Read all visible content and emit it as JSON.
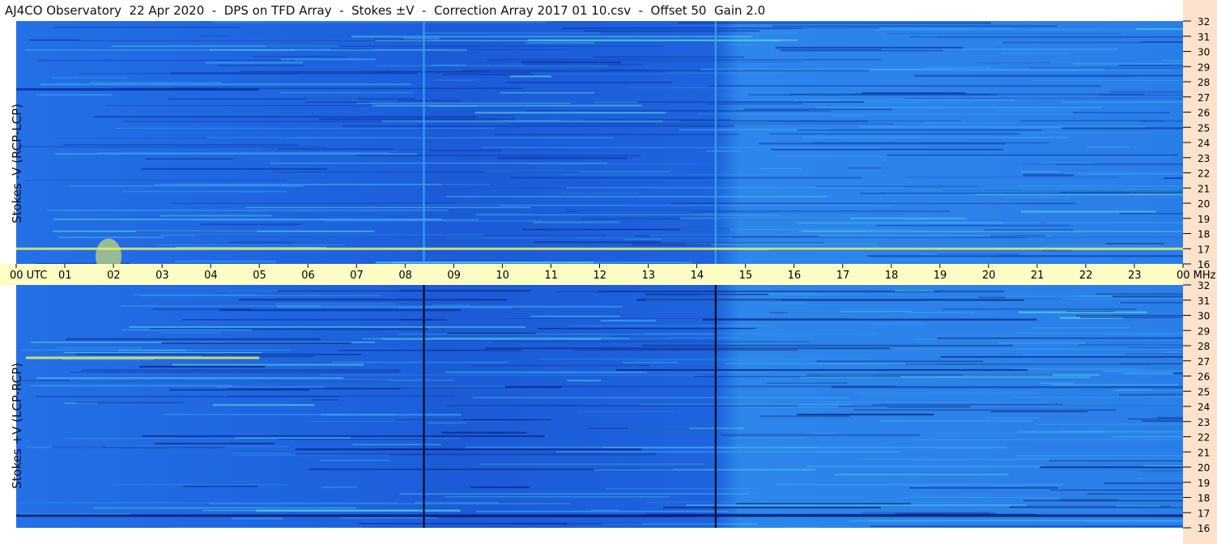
{
  "title": "AJ4CO Observatory  22 Apr 2020  -  DPS on TFD Array  -  Stokes ±V  -  Correction Array 2017 01 10.csv  -  Offset 50  Gain 2.0",
  "chart_data": [
    {
      "type": "heatmap",
      "panel": "top",
      "ylabel": "Stokes -V (RCP-LCP)",
      "x_axis": {
        "ticks": [
          "00",
          "01",
          "02",
          "03",
          "04",
          "05",
          "06",
          "07",
          "08",
          "09",
          "10",
          "11",
          "12",
          "13",
          "14",
          "15",
          "16",
          "17",
          "18",
          "19",
          "20",
          "21",
          "22",
          "23",
          "00"
        ],
        "first_label_suffix": "UTC",
        "last_label_suffix": "MHz",
        "range_hours": [
          0,
          24
        ]
      },
      "y_axis": {
        "ticks": [
          "16",
          "17",
          "18",
          "19",
          "20",
          "21",
          "22",
          "23",
          "24",
          "25",
          "26",
          "27",
          "28",
          "29",
          "30",
          "31",
          "32"
        ],
        "unit": "MHz",
        "range": [
          16,
          32
        ]
      },
      "colors": {
        "base": "#1e62e0",
        "dark": "#0a2fa0",
        "light": "#3aa8f2",
        "bright": "#58e0d8",
        "hot": "#e6f060"
      },
      "features": [
        {
          "kind": "vertical_line",
          "time_h": 8.37,
          "color": "light"
        },
        {
          "kind": "vertical_line",
          "time_h": 14.37,
          "color": "light"
        },
        {
          "kind": "horizontal_band",
          "freq_mhz": 17.0,
          "from_h": 0,
          "to_h": 24,
          "color": "hot"
        },
        {
          "kind": "horizontal_band",
          "freq_mhz": 27.5,
          "from_h": 0,
          "to_h": 5.0,
          "color": "dark"
        },
        {
          "kind": "burst",
          "time_h": 1.9,
          "freq_mhz": 16.5,
          "color": "hot"
        }
      ]
    },
    {
      "type": "heatmap",
      "panel": "bottom",
      "ylabel": "Stokes +V (LCP-RCP)",
      "y_axis": {
        "ticks": [
          "16",
          "17",
          "18",
          "19",
          "20",
          "21",
          "22",
          "23",
          "24",
          "25",
          "26",
          "27",
          "28",
          "29",
          "30",
          "31",
          "32"
        ],
        "unit": "MHz",
        "range": [
          16,
          32
        ]
      },
      "colors": {
        "base": "#1e62e0",
        "dark": "#061a70",
        "light": "#3aa8f2",
        "bright": "#58e0d8",
        "hot": "#e6f060"
      },
      "features": [
        {
          "kind": "vertical_line",
          "time_h": 8.37,
          "color": "black"
        },
        {
          "kind": "vertical_line",
          "time_h": 14.37,
          "color": "black"
        },
        {
          "kind": "horizontal_band",
          "freq_mhz": 27.2,
          "from_h": 0.2,
          "to_h": 5.0,
          "color": "hot"
        },
        {
          "kind": "horizontal_band",
          "freq_mhz": 16.8,
          "from_h": 0,
          "to_h": 24,
          "color": "dark"
        }
      ]
    }
  ]
}
